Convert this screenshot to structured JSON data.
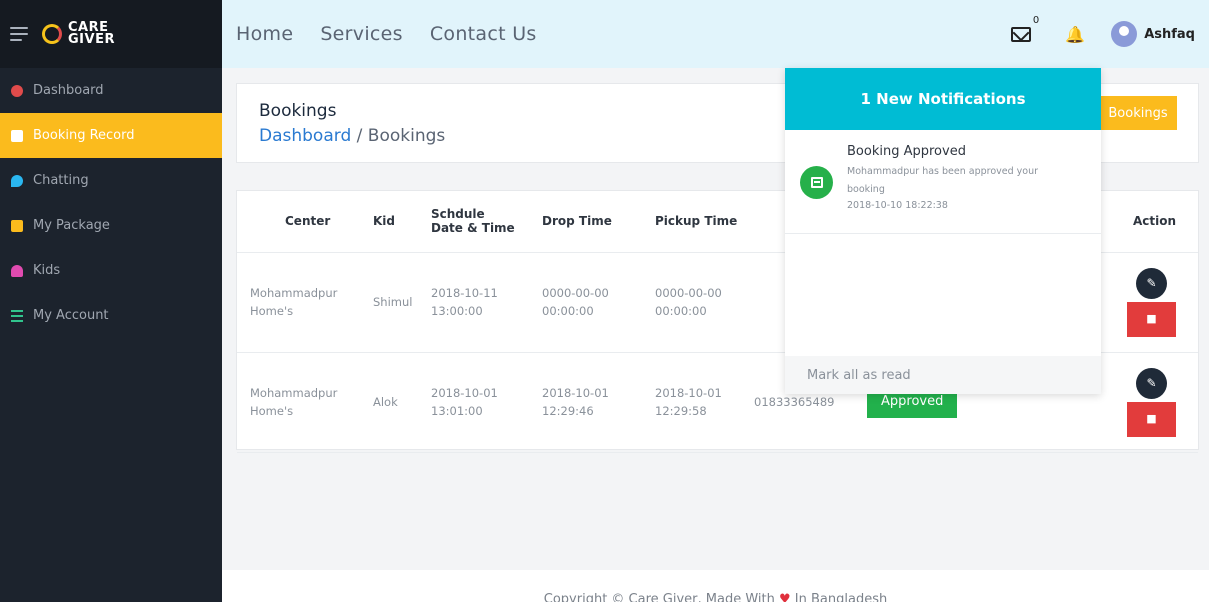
{
  "brand": {
    "line1": "CARE",
    "line2": "GIVER"
  },
  "sidebar": {
    "items": [
      {
        "label": "Dashboard",
        "icon": "dashboard-icon",
        "color": "#e04b4b"
      },
      {
        "label": "Booking Record",
        "icon": "booking-icon",
        "color": "#ffffff",
        "active": true
      },
      {
        "label": "Chatting",
        "icon": "chat-icon",
        "color": "#2ab7f1"
      },
      {
        "label": "My Package",
        "icon": "package-icon",
        "color": "#fbbb1d"
      },
      {
        "label": "Kids",
        "icon": "kids-icon",
        "color": "#e04bb0"
      },
      {
        "label": "My Account",
        "icon": "account-icon",
        "color": "#31c48d"
      }
    ]
  },
  "topnav": {
    "home": "Home",
    "services": "Services",
    "contact": "Contact Us"
  },
  "header": {
    "mail_count": "0",
    "username": "Ashfaq"
  },
  "page": {
    "title": "Bookings",
    "breadcrumb_link": "Dashboard",
    "breadcrumb_sep": "/",
    "breadcrumb_current": "Bookings",
    "button": "Bookings"
  },
  "table": {
    "headers": {
      "center": "Center",
      "kid": "Kid",
      "schedule_1": "Schdule",
      "schedule_2": "Date & Time",
      "drop": "Drop Time",
      "pickup": "Pickup Time",
      "action": "Action"
    },
    "rows": [
      {
        "center_1": "Mohammadpur",
        "center_2": "Home's",
        "kid": "Shimul",
        "sched_date": "2018-10-11",
        "sched_time": "13:00:00",
        "drop_date": "0000-00-00",
        "drop_time": "00:00:00",
        "pick_date": "0000-00-00",
        "pick_time": "00:00:00"
      },
      {
        "center_1": "Mohammadpur",
        "center_2": "Home's",
        "kid": "Alok",
        "sched_date": "2018-10-01",
        "sched_time": "13:01:00",
        "drop_date": "2018-10-01",
        "drop_time": "12:29:46",
        "pick_date": "2018-10-01",
        "pick_time": "12:29:58",
        "phone": "01833365489",
        "status": "Approved"
      }
    ]
  },
  "notifications": {
    "header": "1 New Notifications",
    "item": {
      "title": "Booking Approved",
      "body": "Mohammadpur has been approved your booking",
      "time": "2018-10-10 18:22:38"
    },
    "footer": "Mark all as read"
  },
  "footer": {
    "text_before": "Copyright © Care Giver, Made With",
    "text_after": "In Bangladesh"
  }
}
